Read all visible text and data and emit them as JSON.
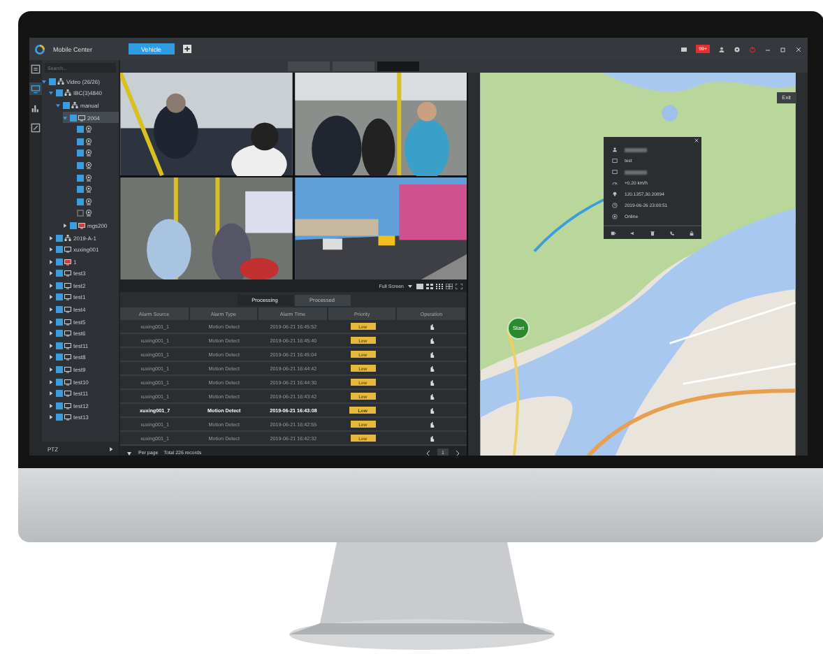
{
  "window": {
    "app_name": "Mobile Center",
    "tabs": [
      {
        "label": "Vehicle",
        "selected": true
      }
    ],
    "alarm_badge": "99+"
  },
  "rail": [
    {
      "selected": false
    },
    {
      "selected": true
    },
    {
      "selected": false
    },
    {
      "selected": false
    }
  ],
  "tree": {
    "search_placeholder": "Search...",
    "items": [
      {
        "label": "Video (26/26)",
        "kind": "group",
        "expanded": true,
        "checked": true,
        "children": [
          {
            "label": "IBC(3)4840",
            "kind": "group",
            "expanded": true,
            "checked": true,
            "children": [
              {
                "label": "manual",
                "kind": "group",
                "expanded": true,
                "checked": true,
                "children": [
                  {
                    "label": "2004",
                    "kind": "device",
                    "expanded": true,
                    "checked": true,
                    "selected": true,
                    "children": [
                      {
                        "kind": "channel",
                        "checked": true
                      },
                      {
                        "kind": "channel",
                        "checked": true
                      },
                      {
                        "kind": "channel",
                        "checked": true
                      },
                      {
                        "kind": "channel",
                        "checked": true
                      },
                      {
                        "kind": "channel",
                        "checked": true
                      },
                      {
                        "kind": "channel",
                        "checked": true
                      },
                      {
                        "kind": "channel",
                        "checked": true
                      },
                      {
                        "kind": "channel",
                        "checked": false
                      }
                    ]
                  },
                  {
                    "label": "mgs200",
                    "kind": "alert-device",
                    "expanded": false,
                    "checked": true
                  }
                ]
              }
            ]
          },
          {
            "label": "2019-A-1",
            "kind": "group",
            "expanded": false,
            "checked": true
          },
          {
            "label": "xuxing001",
            "kind": "device",
            "expanded": false,
            "checked": true
          },
          {
            "label": "1",
            "kind": "alert-device",
            "expanded": false,
            "checked": true
          },
          {
            "label": "test3",
            "kind": "device",
            "expanded": false,
            "checked": true
          },
          {
            "label": "test2",
            "kind": "device",
            "expanded": false,
            "checked": true
          },
          {
            "label": "test1",
            "kind": "device",
            "expanded": false,
            "checked": true
          },
          {
            "label": "test4",
            "kind": "device",
            "expanded": false,
            "checked": true
          },
          {
            "label": "test5",
            "kind": "device",
            "expanded": false,
            "checked": true
          },
          {
            "label": "test6",
            "kind": "device",
            "expanded": false,
            "checked": true
          },
          {
            "label": "test11",
            "kind": "device",
            "expanded": false,
            "checked": true
          },
          {
            "label": "test8",
            "kind": "device",
            "expanded": false,
            "checked": true
          },
          {
            "label": "test9",
            "kind": "device",
            "expanded": false,
            "checked": true
          },
          {
            "label": "test10",
            "kind": "device",
            "expanded": false,
            "checked": true
          },
          {
            "label": "test11",
            "kind": "device",
            "expanded": false,
            "checked": true
          },
          {
            "label": "test12",
            "kind": "device",
            "expanded": false,
            "checked": true
          },
          {
            "label": "test13",
            "kind": "device",
            "expanded": false,
            "checked": true
          }
        ]
      }
    ]
  },
  "ptz_label": "PTZ",
  "view_tabs": [
    {
      "selected": false
    },
    {
      "selected": false
    },
    {
      "selected": true
    }
  ],
  "video_toolbar": {
    "label": "Full Screen"
  },
  "alarms": {
    "tabs": [
      {
        "label": "Processing",
        "selected": true
      },
      {
        "label": "Processed",
        "selected": false
      }
    ],
    "columns": [
      "Alarm Source",
      "Alarm Type",
      "Alarm Time",
      "Priority",
      "Operation"
    ],
    "rows": [
      {
        "source": "xuxing001_1",
        "type": "Motion Detect",
        "time": "2019-06-21 16:45:52",
        "priority": "Low",
        "highlighted": false
      },
      {
        "source": "xuxing001_1",
        "type": "Motion Detect",
        "time": "2019-06-21 16:45:40",
        "priority": "Low",
        "highlighted": false
      },
      {
        "source": "xuxing001_1",
        "type": "Motion Detect",
        "time": "2019-06-21 16:45:04",
        "priority": "Low",
        "highlighted": false
      },
      {
        "source": "xuxing001_1",
        "type": "Motion Detect",
        "time": "2019-06-21 16:44:42",
        "priority": "Low",
        "highlighted": false
      },
      {
        "source": "xuxing001_1",
        "type": "Motion Detect",
        "time": "2019-06-21 16:44:30",
        "priority": "Low",
        "highlighted": false
      },
      {
        "source": "xuxing001_1",
        "type": "Motion Detect",
        "time": "2019-06-21 16:43:42",
        "priority": "Low",
        "highlighted": false
      },
      {
        "source": "xuxing001_7",
        "type": "Motion Detect",
        "time": "2019-06-21 16:43:08",
        "priority": "Low",
        "highlighted": true
      },
      {
        "source": "xuxing001_1",
        "type": "Motion Detect",
        "time": "2019-06-21 16:42:55",
        "priority": "Low",
        "highlighted": false
      },
      {
        "source": "xuxing001_1",
        "type": "Motion Detect",
        "time": "2019-06-21 16:42:32",
        "priority": "Low",
        "highlighted": false
      }
    ],
    "footer": {
      "per_page": "Per page",
      "total": "Total 226 records",
      "page": "1"
    }
  },
  "map": {
    "exit": "Exit",
    "marker": "Start",
    "popup": {
      "rows": [
        {
          "kind": "blurred"
        },
        {
          "kind": "text",
          "text": "test"
        },
        {
          "kind": "blurred"
        },
        {
          "kind": "text",
          "text": "+0.20 km/h"
        },
        {
          "kind": "text",
          "text": "120.1357,30.20894"
        },
        {
          "kind": "text",
          "text": "2019-06-26 23:08:51"
        },
        {
          "kind": "text",
          "text": "Online"
        }
      ]
    }
  }
}
